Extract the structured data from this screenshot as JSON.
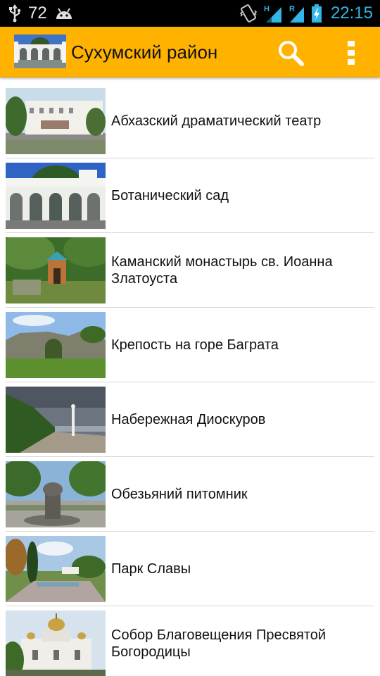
{
  "status_bar": {
    "battery_percent": "72",
    "time": "22:15",
    "icons": [
      "usb-icon",
      "android-icon",
      "vibrate-icon",
      "signal-h-icon",
      "signal-r-icon",
      "battery-charging-icon"
    ]
  },
  "action_bar": {
    "title": "Сухумский район",
    "actions": [
      "search-icon",
      "overflow-menu-icon"
    ],
    "background": "#ffb300"
  },
  "places": [
    {
      "label": "Абхазский драматический театр"
    },
    {
      "label": "Ботанический сад"
    },
    {
      "label": "Каманский монастырь св. Иоанна Златоуста"
    },
    {
      "label": "Крепость на горе Баграта"
    },
    {
      "label": "Набережная Диоскуров"
    },
    {
      "label": "Обезьяний питомник"
    },
    {
      "label": "Парк Славы"
    },
    {
      "label": "Собор Благовещения Пресвятой Богородицы"
    }
  ]
}
